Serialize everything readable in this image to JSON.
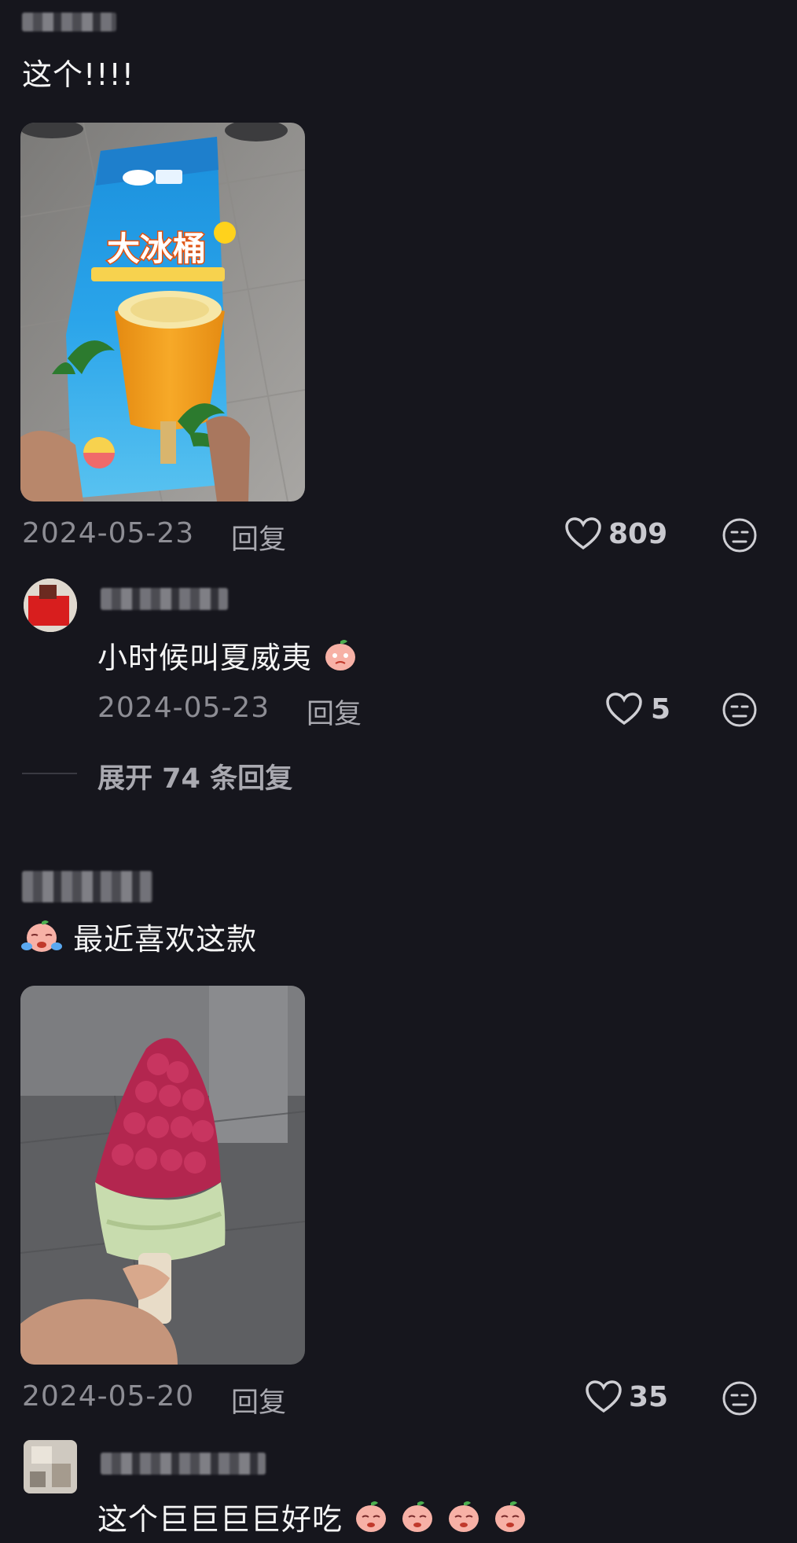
{
  "comments": [
    {
      "text": "这个!!!!",
      "date": "2024-05-23",
      "reply_label": "回复",
      "likes": "809",
      "image_alt": "大冰桶雪糕"
    },
    {
      "text": "小时候叫夏威夷",
      "date": "2024-05-23",
      "reply_label": "回复",
      "likes": "5"
    },
    {
      "text": "最近喜欢这款",
      "date": "2024-05-20",
      "reply_label": "回复",
      "likes": "35"
    },
    {
      "text": "这个巨巨巨巨好吃"
    }
  ],
  "expand_replies": "展开 74 条回复",
  "package_brand": "大冰桶",
  "package_sub": "雪糕",
  "colors": {
    "background": "#16161d",
    "text": "#f4f4f4",
    "meta": "#8d8d94"
  }
}
